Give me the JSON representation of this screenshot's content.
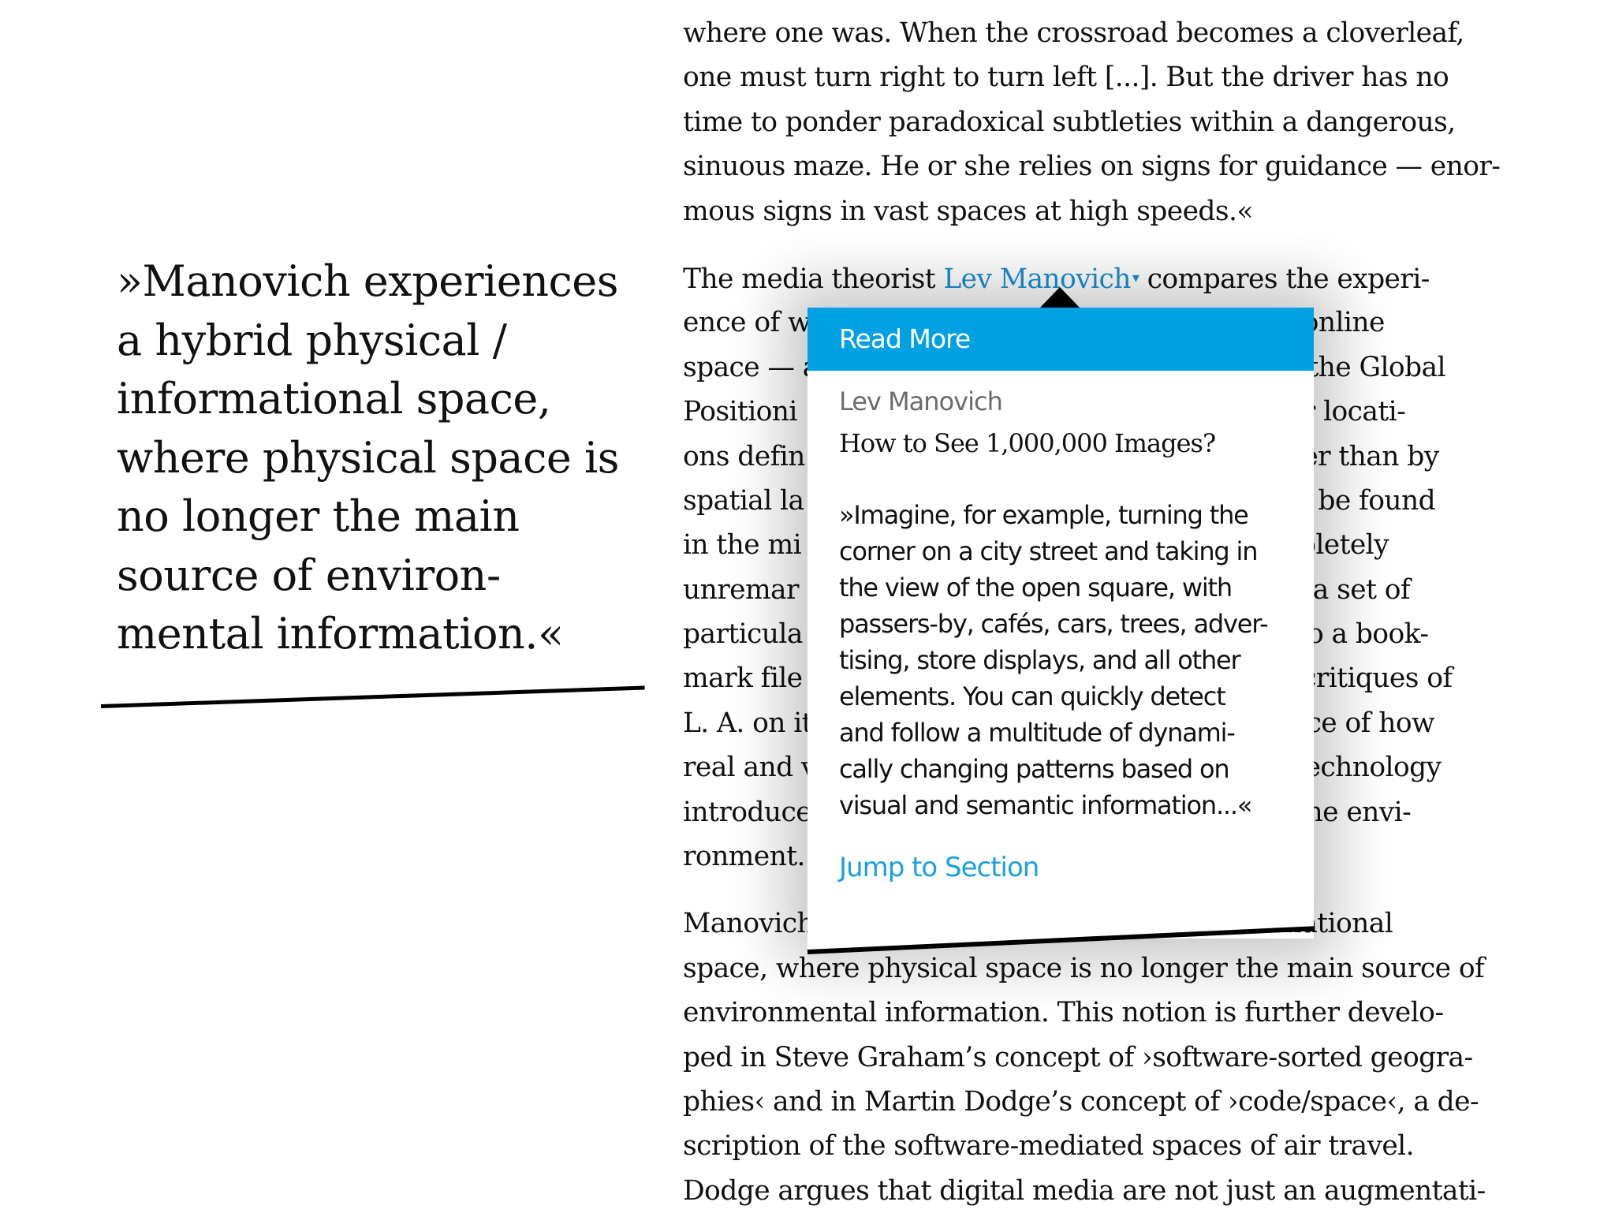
{
  "pull_quote": {
    "lines": [
      "»Manovich experiences",
      "a hybrid physical /",
      "informational space,",
      "where physical space is",
      "no longer the main",
      "source of environ-",
      "mental information.«"
    ]
  },
  "body": {
    "paragraph1_lines": [
      "where one was. When the crossroad becomes a cloverleaf,",
      "one must turn right to turn left [...]. But the driver has no",
      "time to ponder paradoxical subtleties within a dangerous,",
      "sinuous maze. He or she relies on signs for guidance — enor-",
      "mous signs in vast spaces at high speeds.«"
    ],
    "paragraph2_first_line": {
      "before": "The media theorist ",
      "link": "Lev Manovich",
      "caret": "▾",
      "after": " compares the experi-"
    },
    "paragraph2_lines": [
      "ence of w                                                      ing online",
      "space — a                                                      ike the Global",
      "Positioni                                                      icular locati-",
      "ons defin                                                      rather than by",
      "spatial la                                                     b can be found",
      "in the mi                                                      completely",
      "unremar                                                        like a set of",
      "particula                                                      ilar to a book-",
      "mark file                                                      nist critiques of",
      "L. A. on it                                                    erience of how",
      "real and v                                                     er; technology",
      "introduce                                                      ng the envi-",
      "ronment."
    ],
    "paragraph3_lines": [
      "Manovich                                                       rmational",
      "space, where physical space is no longer the main source of",
      "environmental information. This notion is further develo-",
      "ped in Steve Graham’s concept of ›software-sorted geogra-",
      "phies‹ and in Martin Dodge’s concept of ›code/space‹, a de-",
      "scription of the software-mediated spaces of air travel.",
      "Dodge argues that digital media are not just an augmentati-"
    ]
  },
  "popup": {
    "header_label": "Read More",
    "author": "Lev Manovich",
    "title": "How to See 1,000,000 Images?",
    "quote_lines": [
      "»Imagine, for example, turning the",
      "corner on a city street and taking in",
      "the view of the open square, with",
      "passers-by, cafés, cars, trees, adver-",
      "tising, store displays, and all other",
      "elements. You can quickly detect",
      "and follow a multitude of dynami-",
      "cally changing patterns based on",
      "visual and semantic information...«"
    ],
    "jump_label": "Jump to Section"
  },
  "colors": {
    "accent": "#00a0e3",
    "link": "#1a8fd1",
    "text": "#111111",
    "muted": "#6b6b6b"
  }
}
